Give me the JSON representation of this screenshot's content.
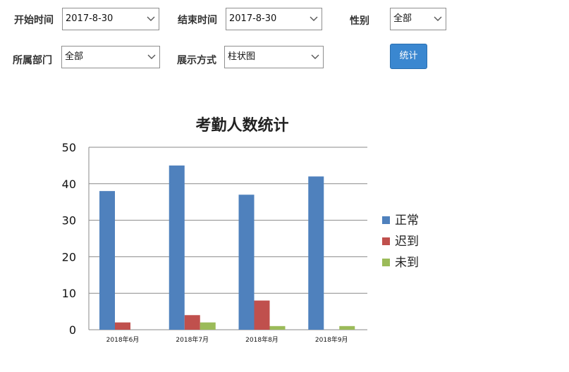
{
  "filters": {
    "start_time": {
      "label": "开始时间",
      "value": "2017-8-30"
    },
    "end_time": {
      "label": "结束时间",
      "value": "2017-8-30"
    },
    "gender": {
      "label": "性别",
      "value": "全部"
    },
    "department": {
      "label": "所属部门",
      "value": "全部"
    },
    "display_mode": {
      "label": "展示方式",
      "value": "柱状图"
    },
    "submit_label": "统计"
  },
  "colors": {
    "normal": "#4f81bd",
    "late": "#c0504d",
    "absent": "#9bbb59",
    "button": "#3a87d0"
  },
  "chart_data": {
    "type": "bar",
    "title": "考勤人数统计",
    "categories": [
      "2018年6月",
      "2018年7月",
      "2018年8月",
      "2018年9月"
    ],
    "series": [
      {
        "name": "正常",
        "values": [
          38,
          45,
          37,
          42
        ]
      },
      {
        "name": "迟到",
        "values": [
          2,
          4,
          8,
          0
        ]
      },
      {
        "name": "未到",
        "values": [
          0,
          2,
          1,
          1
        ]
      }
    ],
    "ylim": [
      0,
      50
    ],
    "yticks": [
      0,
      10,
      20,
      30,
      40,
      50
    ],
    "grid": true,
    "legend": "right"
  }
}
